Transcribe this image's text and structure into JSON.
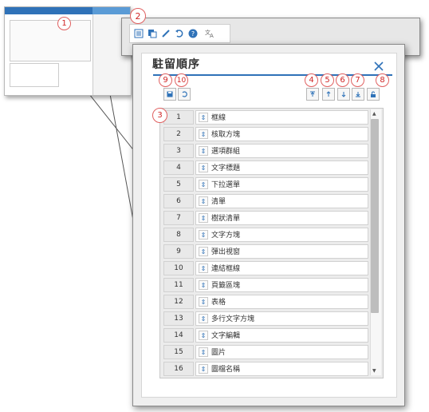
{
  "dialog": {
    "title": "駐留順序",
    "close_icon": "close-icon",
    "left_buttons": [
      {
        "name": "save-icon",
        "badge": "9"
      },
      {
        "name": "refresh-icon",
        "badge": "10"
      }
    ],
    "right_buttons": [
      {
        "name": "move-top-icon",
        "badge": "4"
      },
      {
        "name": "move-up-icon",
        "badge": "5"
      },
      {
        "name": "move-down-icon",
        "badge": "6"
      },
      {
        "name": "move-bottom-icon",
        "badge": "7"
      },
      {
        "name": "lock-icon",
        "badge": "8"
      }
    ],
    "list_badge": "3",
    "items": [
      {
        "num": "1",
        "label": "框線"
      },
      {
        "num": "2",
        "label": "核取方塊"
      },
      {
        "num": "3",
        "label": "選項群組"
      },
      {
        "num": "4",
        "label": "文字標題"
      },
      {
        "num": "5",
        "label": "下拉選單"
      },
      {
        "num": "6",
        "label": "清單"
      },
      {
        "num": "7",
        "label": "樹狀清單"
      },
      {
        "num": "8",
        "label": "文字方塊"
      },
      {
        "num": "9",
        "label": "彈出視窗"
      },
      {
        "num": "10",
        "label": "連結框線"
      },
      {
        "num": "11",
        "label": "頁籤區塊"
      },
      {
        "num": "12",
        "label": "表格"
      },
      {
        "num": "13",
        "label": "多行文字方塊"
      },
      {
        "num": "14",
        "label": "文字編輯"
      },
      {
        "num": "15",
        "label": "圖片"
      },
      {
        "num": "16",
        "label": "圖檔名稱"
      }
    ]
  },
  "callouts": {
    "mini_badge": "1",
    "toolbar_badge": "2"
  },
  "toolbar": {
    "icons": [
      "order-list-icon",
      "copy-order-icon",
      "edit-icon",
      "rotate-icon",
      "help-icon",
      "translate-icon"
    ]
  },
  "colors": {
    "accent": "#2f72b8",
    "badge": "#d02525"
  }
}
